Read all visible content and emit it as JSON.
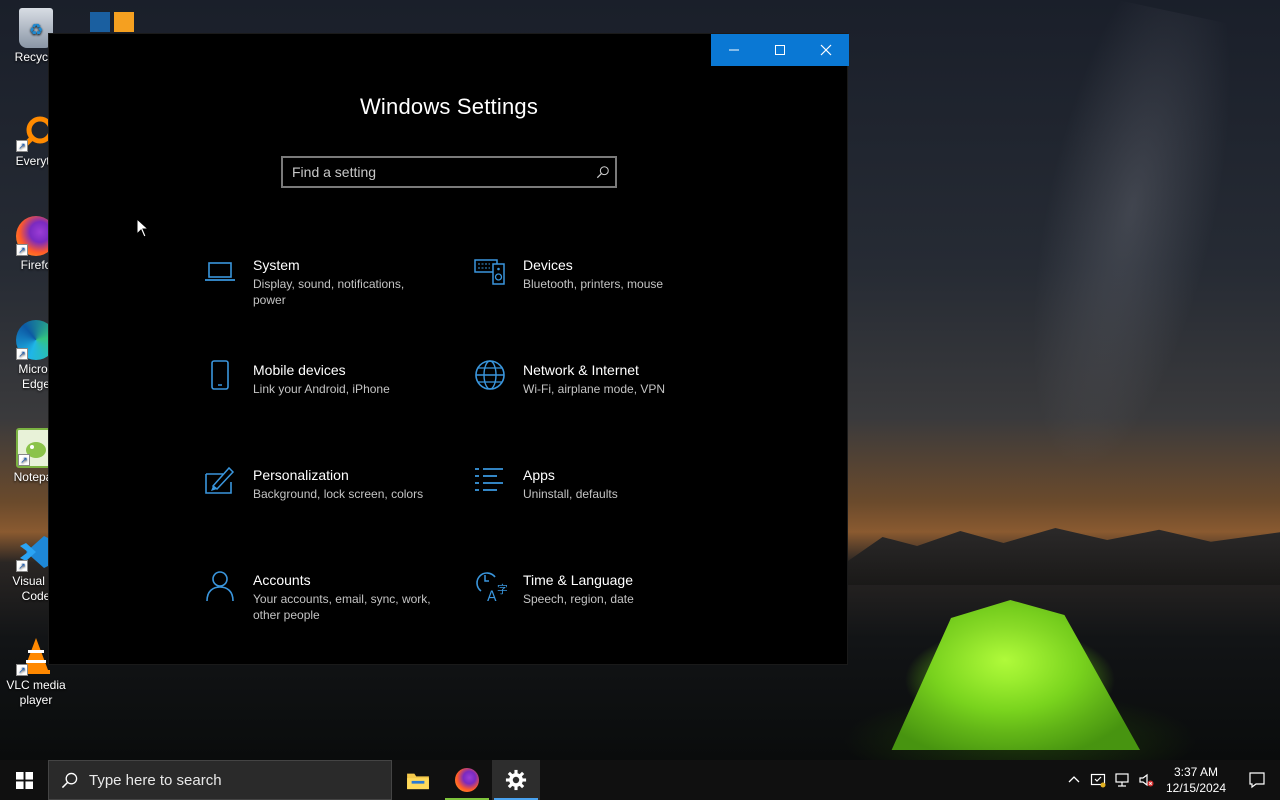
{
  "desktop": {
    "icons": [
      {
        "label": "Recycle",
        "glyph": "recycle-bin-icon"
      },
      {
        "label": "Everyth",
        "glyph": "everything-search-icon"
      },
      {
        "label": "Firefo",
        "glyph": "firefox-icon"
      },
      {
        "label": "Micros\nEdge",
        "glyph": "edge-icon"
      },
      {
        "label": "Notepac",
        "glyph": "notepad-plus-plus-icon"
      },
      {
        "label": "Visual St\nCode",
        "glyph": "vscode-icon"
      },
      {
        "label": "VLC media\nplayer",
        "glyph": "vlc-icon"
      }
    ]
  },
  "window": {
    "title": "Windows Settings",
    "search_placeholder": "Find a setting",
    "accent": "#0a78d4",
    "tiles": [
      {
        "name": "System",
        "desc": "Display, sound, notifications, power",
        "icon": "laptop-icon"
      },
      {
        "name": "Devices",
        "desc": "Bluetooth, printers, mouse",
        "icon": "keyboard-speaker-icon"
      },
      {
        "name": "Mobile devices",
        "desc": "Link your Android, iPhone",
        "icon": "phone-icon"
      },
      {
        "name": "Network & Internet",
        "desc": "Wi-Fi, airplane mode, VPN",
        "icon": "globe-icon"
      },
      {
        "name": "Personalization",
        "desc": "Background, lock screen, colors",
        "icon": "paint-icon"
      },
      {
        "name": "Apps",
        "desc": "Uninstall, defaults",
        "icon": "apps-list-icon"
      },
      {
        "name": "Accounts",
        "desc": "Your accounts, email, sync, work, other people",
        "icon": "person-icon"
      },
      {
        "name": "Time & Language",
        "desc": "Speech, region, date",
        "icon": "time-language-icon"
      }
    ]
  },
  "taskbar": {
    "search_placeholder": "Type here to search",
    "time": "3:37 AM",
    "date": "12/15/2024"
  }
}
